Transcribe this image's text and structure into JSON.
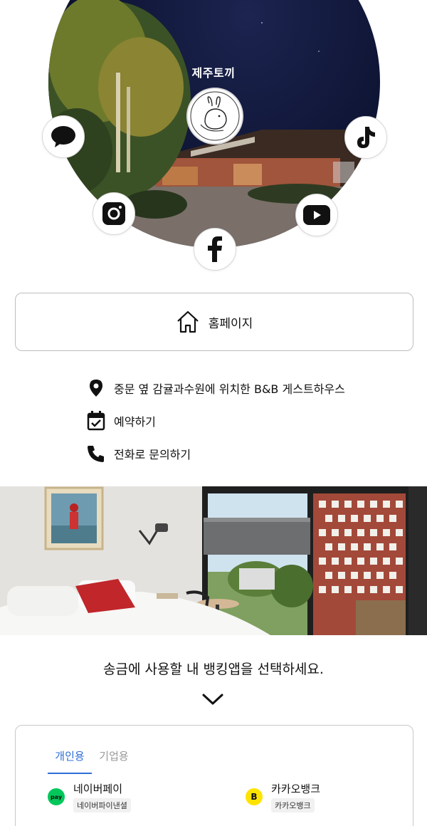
{
  "brand": {
    "title": "제주토끼",
    "logo_alt": "JEJU TOKKI B and B"
  },
  "social": [
    "kakaotalk-icon",
    "tiktok-icon",
    "instagram-icon",
    "youtube-icon",
    "facebook-icon"
  ],
  "homepage": {
    "label": "홈페이지"
  },
  "info": {
    "location": "중문 옆 감귤과수원에 위치한 B&B 게스트하우스",
    "reserve": "예약하기",
    "phone": "전화로 문의하기"
  },
  "banking": {
    "title": "송금에 사용할 내 뱅킹앱을 선택하세요.",
    "tabs": [
      "개인용",
      "기업용"
    ],
    "apps": [
      {
        "name": "네이버페이",
        "sub": "네이버파이낸셜",
        "icon_text": "pay",
        "color": "#03c75a"
      },
      {
        "name": "카카오뱅크",
        "sub": "카카오뱅크",
        "icon_text": "B",
        "color": "#ffe300"
      }
    ]
  },
  "colors": {
    "accent": "#2e6fd8",
    "border": "#bdbdbd"
  }
}
